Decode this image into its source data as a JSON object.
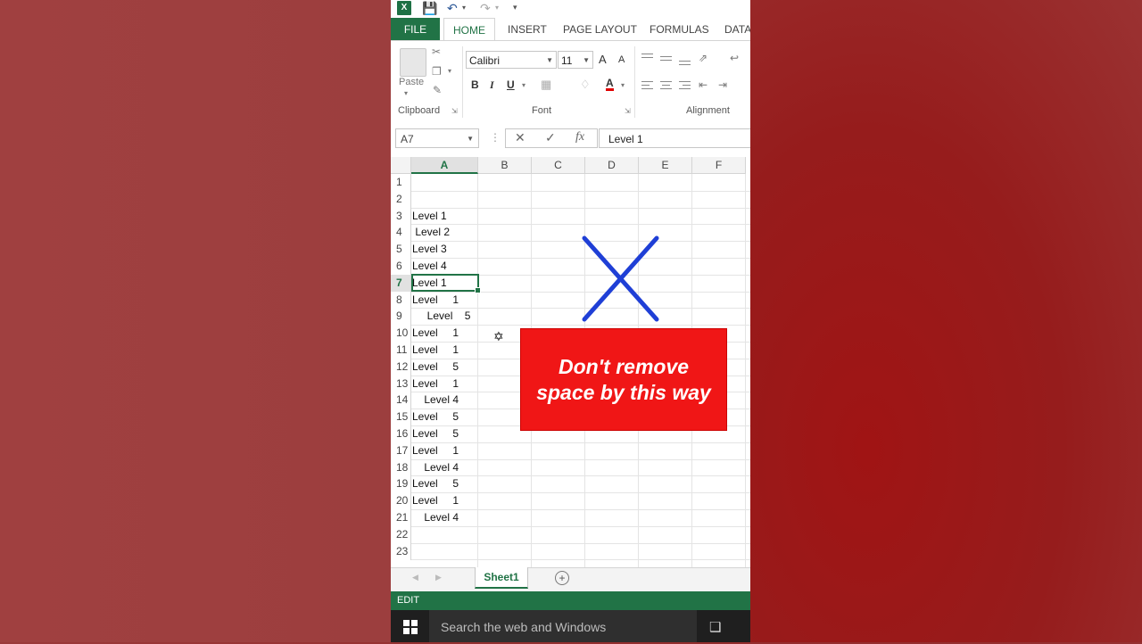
{
  "ribbon_tabs": [
    "FILE",
    "HOME",
    "INSERT",
    "PAGE LAYOUT",
    "FORMULAS",
    "DATA"
  ],
  "clipboard": {
    "paste_label": "Paste",
    "group_label": "Clipboard"
  },
  "font": {
    "name": "Calibri",
    "size": "11",
    "group_label": "Font",
    "bold": "B",
    "italic": "I",
    "underline": "U",
    "grow": "A",
    "shrink": "A",
    "font_color": "A"
  },
  "alignment": {
    "group_label": "Alignment"
  },
  "formula_bar": {
    "name_box": "A7",
    "content": "Level 1",
    "cancel": "✕",
    "enter": "✓",
    "fx": "fx"
  },
  "columns": [
    "A",
    "B",
    "C",
    "D",
    "E",
    "F"
  ],
  "rows": [
    {
      "n": "1",
      "a": ""
    },
    {
      "n": "2",
      "a": ""
    },
    {
      "n": "3",
      "a": "Level 1"
    },
    {
      "n": "4",
      "a": " Level 2"
    },
    {
      "n": "5",
      "a": "Level 3"
    },
    {
      "n": "6",
      "a": "Level 4"
    },
    {
      "n": "7",
      "a": "Level 1"
    },
    {
      "n": "8",
      "a": "Level     1"
    },
    {
      "n": "9",
      "a": "     Level    5"
    },
    {
      "n": "10",
      "a": "Level     1"
    },
    {
      "n": "11",
      "a": "Level     1"
    },
    {
      "n": "12",
      "a": "Level     5"
    },
    {
      "n": "13",
      "a": "Level     1"
    },
    {
      "n": "14",
      "a": "    Level 4"
    },
    {
      "n": "15",
      "a": "Level     5"
    },
    {
      "n": "16",
      "a": "Level     5"
    },
    {
      "n": "17",
      "a": "Level     1"
    },
    {
      "n": "18",
      "a": "    Level 4"
    },
    {
      "n": "19",
      "a": "Level     5"
    },
    {
      "n": "20",
      "a": "Level     1"
    },
    {
      "n": "21",
      "a": "    Level 4"
    },
    {
      "n": "22",
      "a": ""
    },
    {
      "n": "23",
      "a": ""
    }
  ],
  "active_row": "7",
  "sheet_tab": "Sheet1",
  "status": "EDIT",
  "taskbar": {
    "search_placeholder": "Search the web and Windows"
  },
  "overlay": {
    "line1": "Don't remove",
    "line2": "space by this way"
  },
  "colors": {
    "excel_green": "#217346",
    "overlay_red": "#f01616",
    "x_blue": "#1f3fd6"
  }
}
